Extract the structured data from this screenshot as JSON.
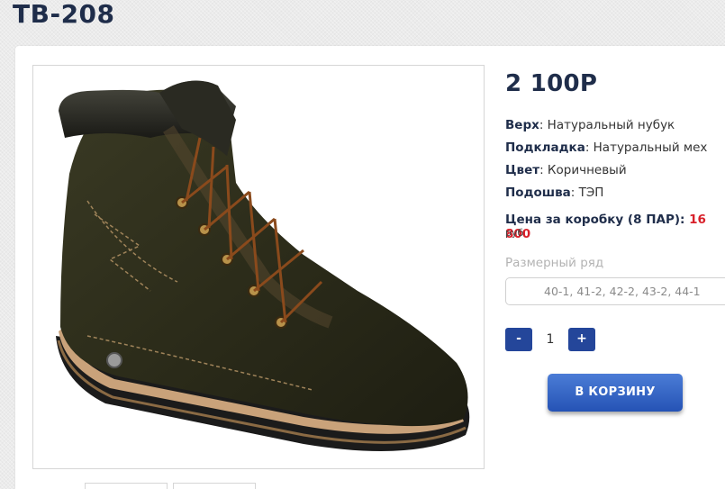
{
  "product": {
    "title": "TB-208",
    "price": "2 100Р",
    "image_alt": "boot-photo"
  },
  "specs": [
    {
      "label": "Верх",
      "value": ": Натуральный нубук"
    },
    {
      "label": "Подкладка",
      "value": ": Натуральный мех"
    },
    {
      "label": "Цвет",
      "value": ": Коричневый"
    },
    {
      "label": "Подошва",
      "value": ": ТЭП"
    }
  ],
  "box_price": {
    "label": "Цена за коробку (8 ПАР): ",
    "value": "16 800",
    "currency": "руб"
  },
  "size": {
    "label": "Размерный ряд",
    "value": "40-1, 41-2, 42-2, 43-2, 44-1"
  },
  "quantity": {
    "minus": "-",
    "value": "1",
    "plus": "+"
  },
  "cart_button": "В КОРЗИНУ",
  "colors": {
    "brand": "#24469a",
    "price_red": "#d8202a",
    "title": "#1f2d4a"
  }
}
